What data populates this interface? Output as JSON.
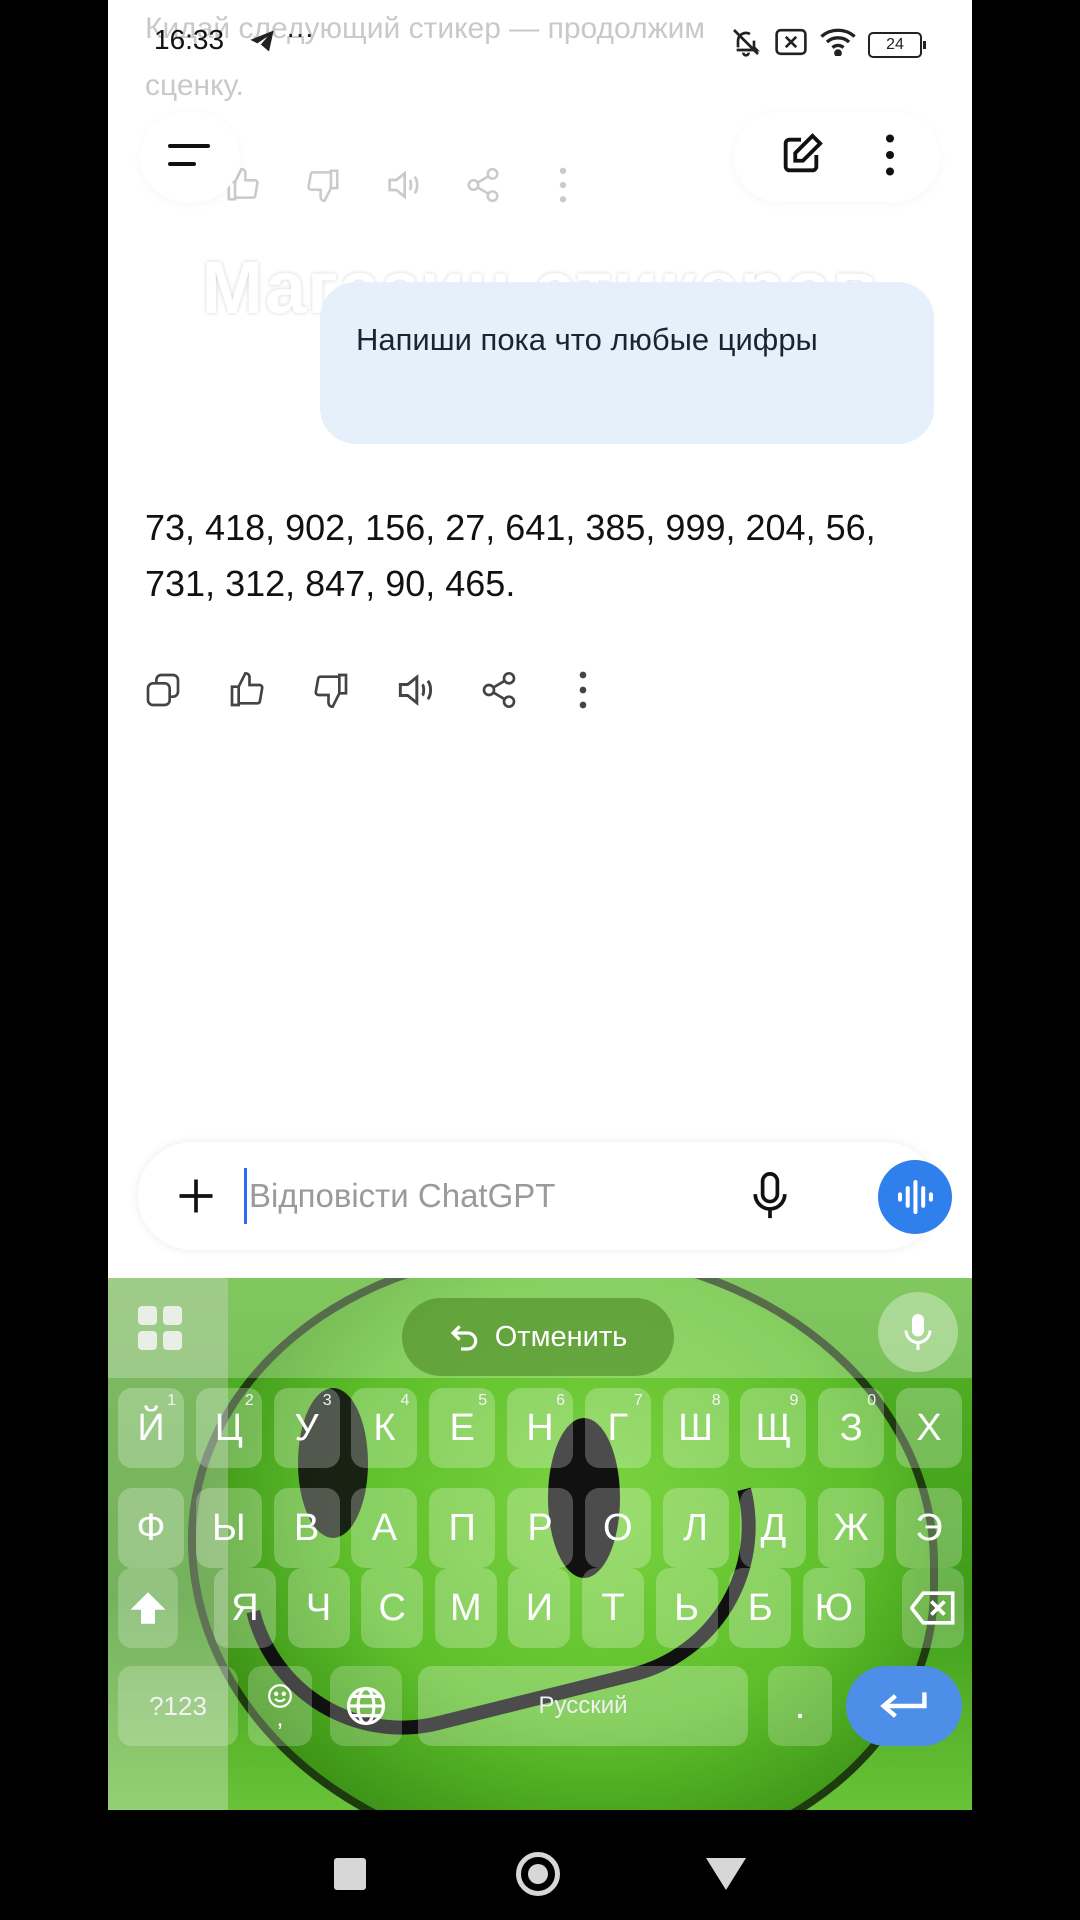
{
  "status_bar": {
    "time": "16:33",
    "dots": "···",
    "battery": "24"
  },
  "background": {
    "faded_text_line1": "Кидай следующий стикер — продолжим",
    "faded_text_line2": "сценку.",
    "overlay_title": "Магазин стикеров"
  },
  "chat": {
    "user_message": "Напиши пока что любые цифры",
    "assistant_reply": "73, 418, 902, 156, 27, 641, 385, 999, 204, 56, 731, 312, 847, 90, 465."
  },
  "composer": {
    "placeholder": "Відповісти ChatGPT",
    "value": ""
  },
  "keyboard": {
    "undo_label": "Отменить",
    "row1": [
      {
        "label": "Й",
        "hint": "1"
      },
      {
        "label": "Ц",
        "hint": "2"
      },
      {
        "label": "У",
        "hint": "3"
      },
      {
        "label": "К",
        "hint": "4"
      },
      {
        "label": "Е",
        "hint": "5"
      },
      {
        "label": "Н",
        "hint": "6"
      },
      {
        "label": "Г",
        "hint": "7"
      },
      {
        "label": "Ш",
        "hint": "8"
      },
      {
        "label": "Щ",
        "hint": "9"
      },
      {
        "label": "З",
        "hint": "0"
      },
      {
        "label": "Х",
        "hint": ""
      }
    ],
    "row2": [
      "Ф",
      "Ы",
      "В",
      "А",
      "П",
      "Р",
      "О",
      "Л",
      "Д",
      "Ж",
      "Э"
    ],
    "row3": [
      "Я",
      "Ч",
      "С",
      "М",
      "И",
      "Т",
      "Ь",
      "Б",
      "Ю"
    ],
    "symbols_label": "?123",
    "comma_label": ",",
    "space_label": "Русский",
    "period_label": "."
  }
}
